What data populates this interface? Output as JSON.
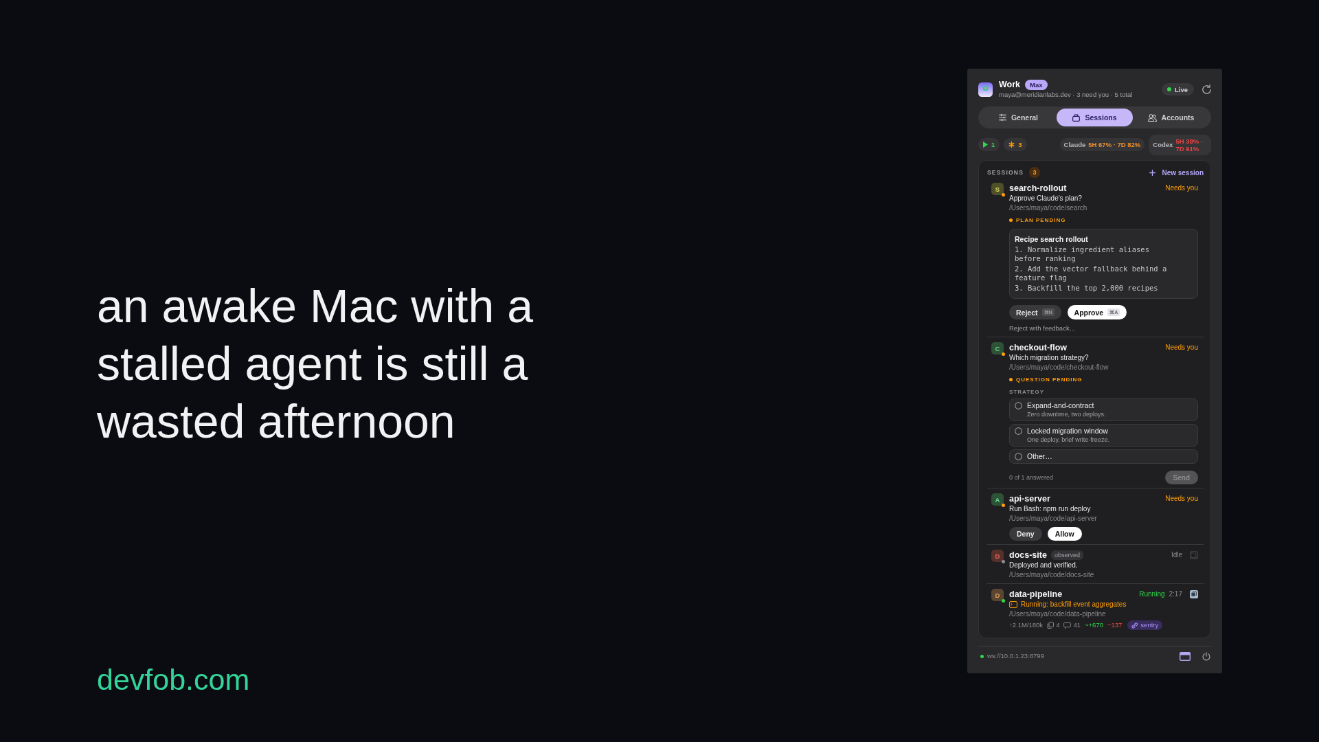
{
  "headline": {
    "text": "an awake Mac with a stalled agent is still a wasted afternoon"
  },
  "site": {
    "label": "devfob.com"
  },
  "panel": {
    "header": {
      "title": "Work",
      "plan_badge": "Max",
      "subtitle": "maya@meridianlabs.dev · 3 need you · 5 total",
      "status": {
        "label": "Live"
      }
    },
    "tabs": [
      {
        "label": "General",
        "selected": false
      },
      {
        "label": "Sessions",
        "selected": true
      },
      {
        "label": "Accounts",
        "selected": false
      }
    ],
    "counters": [
      {
        "kind": "running",
        "label": "1"
      },
      {
        "kind": "waiting",
        "label": "3"
      }
    ],
    "usage": [
      {
        "label": "Claude",
        "value": "5H 67% · 7D 82%",
        "kind": "warning"
      },
      {
        "label": "Codex",
        "value": "5H 38% · 7D 91%",
        "kind": "critical"
      }
    ],
    "sessions": {
      "title": "SESSIONS",
      "count": "3",
      "action": "New session",
      "items": [
        {
          "kind": "plan",
          "initial": "S",
          "color": "#4f4f2a",
          "name": "search-rollout",
          "status": {
            "label": "Needs you",
            "kind": "attention"
          },
          "summary": "Approve Claude's plan?",
          "path": "/Users/maya/code/search",
          "pending": "PLAN PENDING",
          "plan": {
            "title": "Recipe search rollout",
            "steps": [
              "1. Normalize ingredient aliases before ranking",
              "2. Add the vector fallback behind a feature flag",
              "3. Backfill the top 2,000 recipes"
            ]
          },
          "actions": [
            {
              "label": "Reject",
              "shortcut": "⌘N",
              "primary": false
            },
            {
              "label": "Approve",
              "shortcut": "⌘A",
              "primary": true
            }
          ],
          "feedback_link": "Reject with feedback…"
        },
        {
          "kind": "question",
          "initial": "C",
          "color": "#2e5238",
          "name": "checkout-flow",
          "status": {
            "label": "Needs you",
            "kind": "attention"
          },
          "summary": "Which migration strategy?",
          "path": "/Users/maya/code/checkout-flow",
          "pending": "QUESTION PENDING",
          "question": {
            "label": "STRATEGY",
            "options": [
              {
                "title": "Expand-and-contract",
                "detail": "Zero downtime, two deploys.",
                "selected": false
              },
              {
                "title": "Locked migration window",
                "detail": "One deploy, brief write-freeze.",
                "selected": false
              },
              {
                "title": "Other…",
                "selected": false
              }
            ],
            "progress": "0 of 1 answered",
            "complete": false,
            "submit": {
              "label": "Send",
              "disabled": true
            }
          }
        },
        {
          "kind": "permission",
          "initial": "A",
          "color": "#2e5238",
          "name": "api-server",
          "status": {
            "label": "Needs you",
            "kind": "attention"
          },
          "summary": "Run Bash: npm run deploy",
          "path": "/Users/maya/code/api-server",
          "actions": [
            {
              "label": "Deny",
              "primary": false
            },
            {
              "label": "Allow",
              "primary": true
            }
          ]
        },
        {
          "kind": "idle",
          "initial": "D",
          "color": "#57302c",
          "name": "docs-site",
          "tag": "observed",
          "status": {
            "label": "Idle",
            "kind": "idle"
          },
          "terminal_active": false,
          "summary": "Deployed and verified.",
          "path": "/Users/maya/code/docs-site"
        },
        {
          "kind": "running",
          "initial": "D",
          "color": "#5a4630",
          "name": "data-pipeline",
          "status": {
            "label": "Running",
            "kind": "running"
          },
          "elapsed": "2:17",
          "terminal_active": true,
          "activity": "Running: backfill event aggregates",
          "path": "/Users/maya/code/data-pipeline",
          "stats": [
            {
              "kind": "tokens",
              "label": "↑2.1M/180k"
            },
            {
              "kind": "files",
              "label": "4"
            },
            {
              "kind": "messages",
              "label": "41"
            },
            {
              "kind": "added",
              "label": "~+670"
            },
            {
              "kind": "removed",
              "label": "−137"
            }
          ],
          "tags": [
            {
              "label": "sentry"
            }
          ]
        }
      ]
    },
    "footer": {
      "endpoint": "ws://10.0.1.23:8799",
      "connected": true
    }
  }
}
